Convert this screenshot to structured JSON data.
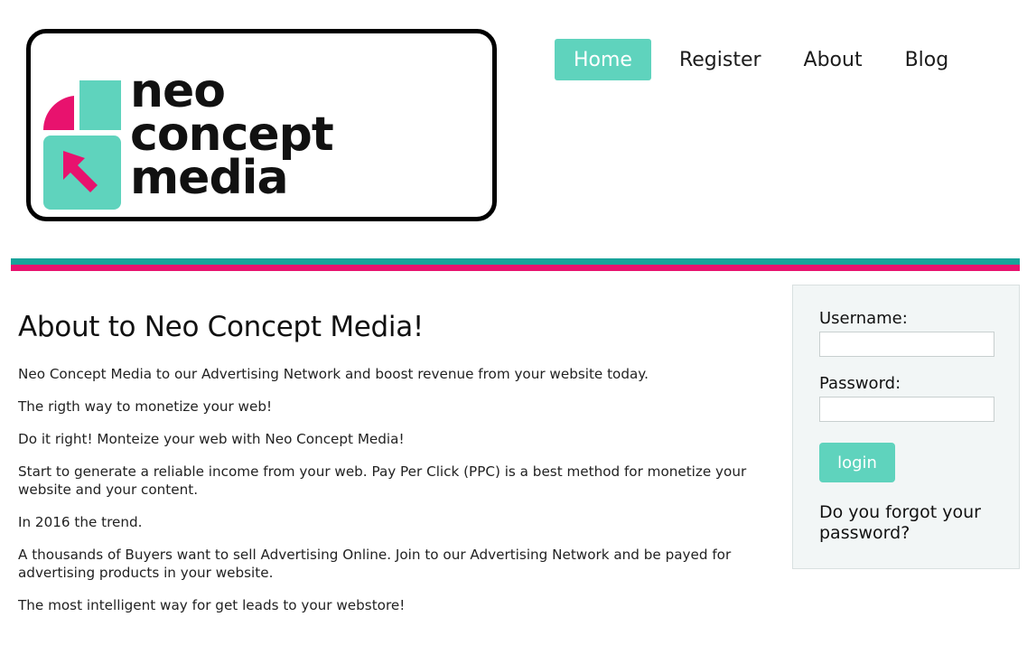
{
  "logo": {
    "lines": [
      "neo",
      "concept",
      "media"
    ],
    "colors": {
      "teal": "#5fd3bd",
      "pink": "#e8126e",
      "border": "#000000"
    }
  },
  "nav": {
    "items": [
      {
        "label": "Home",
        "active": true
      },
      {
        "label": "Register",
        "active": false
      },
      {
        "label": "About",
        "active": false
      },
      {
        "label": "Blog",
        "active": false
      }
    ]
  },
  "divider": {
    "top_color": "#18a39a",
    "bottom_color": "#e8126e"
  },
  "main": {
    "title": "About to Neo Concept Media!",
    "paragraphs": [
      "Neo Concept Media to our Advertising Network and boost revenue from your website today.",
      "The rigth way to monetize your web!",
      "Do it right! Monteize your web with Neo Concept Media!",
      "Start to generate a reliable income from your web. Pay Per Click (PPC) is a best method for monetize your website and your content.",
      "In 2016 the trend.",
      "A thousands of Buyers want to sell Advertising Online. Join to our Advertising Network and be payed for advertising products in your website.",
      "The most intelligent way for get leads to your webstore!"
    ]
  },
  "login": {
    "username_label": "Username:",
    "username_value": "",
    "password_label": "Password:",
    "password_value": "",
    "button_label": "login",
    "forgot_label": "Do you forgot your password?"
  }
}
